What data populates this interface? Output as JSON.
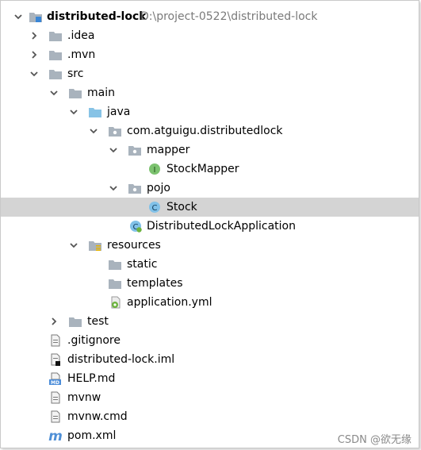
{
  "tree": {
    "root": {
      "label": "distributed-lock",
      "path": "D:\\project-0522\\distributed-lock"
    },
    "items": [
      {
        "label": ".idea"
      },
      {
        "label": ".mvn"
      },
      {
        "label": "src"
      },
      {
        "label": "main"
      },
      {
        "label": "java"
      },
      {
        "label": "com.atguigu.distributedlock"
      },
      {
        "label": "mapper"
      },
      {
        "label": "StockMapper"
      },
      {
        "label": "pojo"
      },
      {
        "label": "Stock"
      },
      {
        "label": "DistributedLockApplication"
      },
      {
        "label": "resources"
      },
      {
        "label": "static"
      },
      {
        "label": "templates"
      },
      {
        "label": "application.yml"
      },
      {
        "label": "test"
      },
      {
        "label": ".gitignore"
      },
      {
        "label": "distributed-lock.iml"
      },
      {
        "label": "HELP.md"
      },
      {
        "label": "mvnw"
      },
      {
        "label": "mvnw.cmd"
      },
      {
        "label": "pom.xml"
      }
    ],
    "selected_item": "Stock"
  },
  "icons": {
    "interface_letter": "I",
    "class_letter": "C",
    "md_letters": "MD",
    "maven_letter": "m"
  },
  "colors": {
    "folder": "#a9b3bd",
    "source_folder": "#87c3e6",
    "resources_stripes": "#e6b400",
    "interface_badge": "#7cc26f",
    "class_badge": "#81c1e8",
    "selection": "#d4d4d4",
    "maven": "#4f8fd6"
  },
  "watermark": "CSDN @欲无缘"
}
